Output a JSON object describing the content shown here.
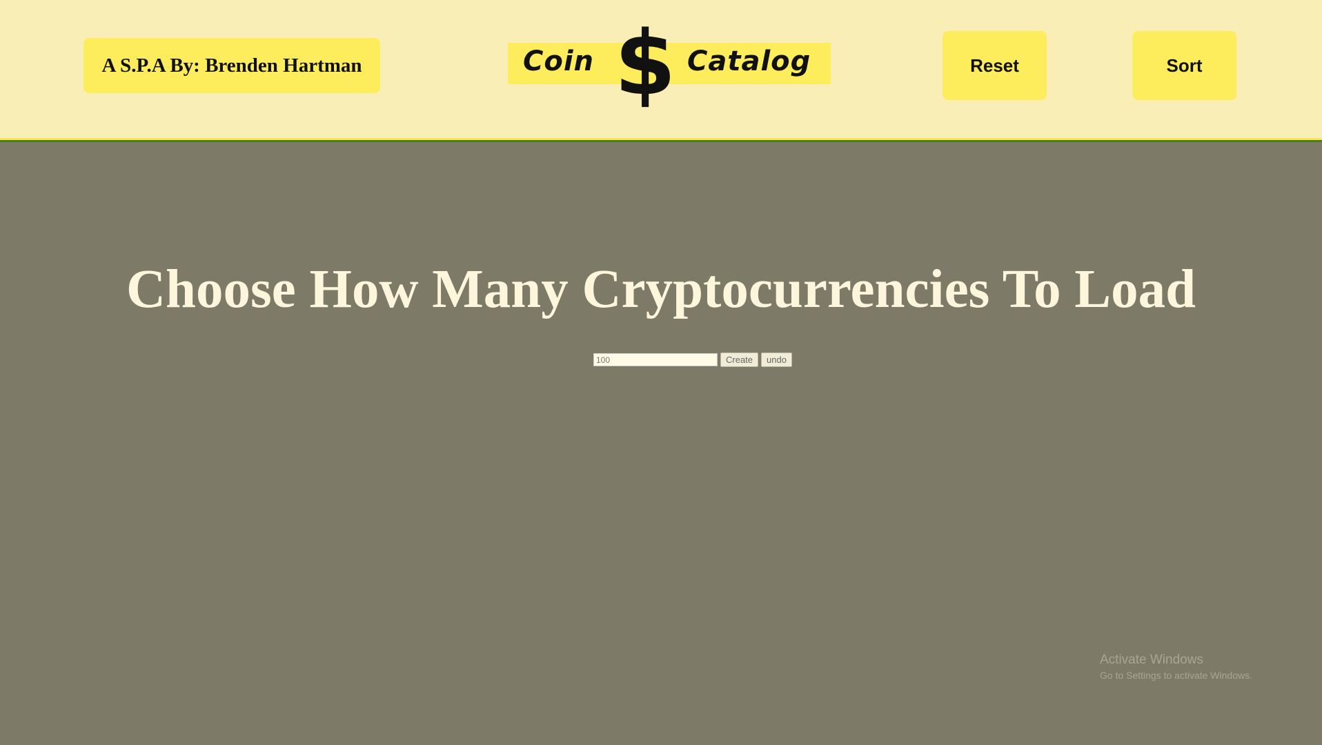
{
  "header": {
    "author_label": "A S.P.A By: Brenden Hartman",
    "logo": {
      "word_left": "Coin",
      "symbol": "$",
      "word_right": "Catalog"
    },
    "reset_label": "Reset",
    "sort_label": "Sort"
  },
  "main": {
    "title": "Choose How Many Cryptocurrencies To Load",
    "count_input_value": "100",
    "create_label": "Create",
    "undo_label": "undo"
  },
  "watermark": {
    "title": "Activate Windows",
    "subtitle": "Go to Settings to activate Windows."
  },
  "colors": {
    "page_background": "#7d7a67",
    "header_background": "#f9efb6",
    "accent_yellow": "#fded5d",
    "header_border_green": "#4f7a28",
    "title_text": "#fdf6dc"
  }
}
